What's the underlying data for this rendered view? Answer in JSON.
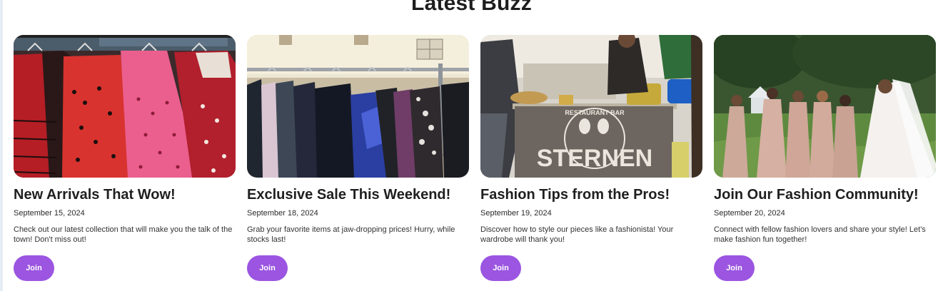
{
  "section": {
    "title": "Latest Buzz"
  },
  "cards": [
    {
      "title": "New Arrivals That Wow!",
      "date": "September 15, 2024",
      "description": "Check out our latest collection that will make you the talk of the town! Don't miss out!",
      "button_label": "Join"
    },
    {
      "title": "Exclusive Sale This Weekend!",
      "date": "September 18, 2024",
      "description": "Grab your favorite items at jaw-dropping prices! Hurry, while stocks last!",
      "button_label": "Join"
    },
    {
      "title": "Fashion Tips from the Pros!",
      "date": "September 19, 2024",
      "description": "Discover how to style our pieces like a fashionista! Your wardrobe will thank you!",
      "button_label": "Join",
      "image_sign_text": "STERNEN",
      "image_sign_arc_text": "RESTAURANT BAR"
    },
    {
      "title": "Join Our Fashion Community!",
      "date": "September 20, 2024",
      "description": "Connect with fellow fashion lovers and share your style! Let's make fashion fun together!",
      "button_label": "Join"
    }
  ],
  "colors": {
    "accent": "#9b55e0",
    "text": "#1f1f1f",
    "background": "#ffffff"
  }
}
